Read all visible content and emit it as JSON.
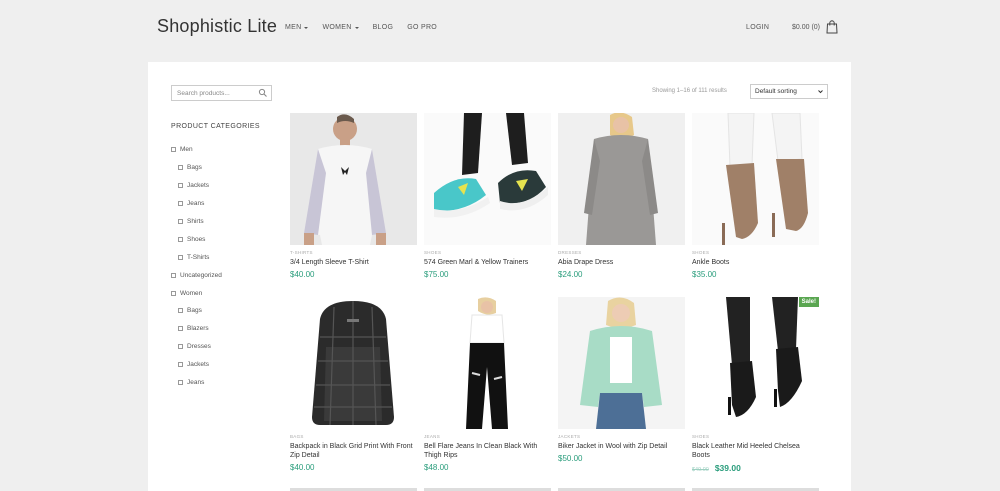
{
  "header": {
    "logo": "Shophistic Lite",
    "nav": [
      {
        "label": "MEN",
        "dropdown": true
      },
      {
        "label": "WOMEN",
        "dropdown": true
      },
      {
        "label": "BLOG",
        "dropdown": false
      },
      {
        "label": "GO PRO",
        "dropdown": false
      }
    ],
    "login": "LOGIN",
    "cart": "$0.00 (0)"
  },
  "sidebar": {
    "search_placeholder": "Search products...",
    "categories_heading": "PRODUCT CATEGORIES",
    "categories": [
      {
        "label": "Men",
        "level": 0
      },
      {
        "label": "Bags",
        "level": 1
      },
      {
        "label": "Jackets",
        "level": 1
      },
      {
        "label": "Jeans",
        "level": 1
      },
      {
        "label": "Shirts",
        "level": 1
      },
      {
        "label": "Shoes",
        "level": 1
      },
      {
        "label": "T-Shirts",
        "level": 1
      },
      {
        "label": "Uncategorized",
        "level": 0
      },
      {
        "label": "Women",
        "level": 0
      },
      {
        "label": "Bags",
        "level": 1
      },
      {
        "label": "Blazers",
        "level": 1
      },
      {
        "label": "Dresses",
        "level": 1
      },
      {
        "label": "Jackets",
        "level": 1
      },
      {
        "label": "Jeans",
        "level": 1
      }
    ]
  },
  "toolbar": {
    "results": "Showing 1–16 of 111 results",
    "sorting": "Default sorting"
  },
  "products": [
    {
      "category": "T-SHIRTS",
      "name": "3/4 Length Sleeve T-Shirt",
      "price": "$40.00"
    },
    {
      "category": "SHOES",
      "name": "574 Green Marl & Yellow Trainers",
      "price": "$75.00"
    },
    {
      "category": "DRESSES",
      "name": "Abia Drape Dress",
      "price": "$24.00"
    },
    {
      "category": "SHOES",
      "name": "Ankle Boots",
      "price": "$35.00"
    },
    {
      "category": "BAGS",
      "name": "Backpack in Black Grid Print With Front Zip Detail",
      "price": "$40.00"
    },
    {
      "category": "JEANS",
      "name": "Bell Flare Jeans In Clean Black With Thigh Rips",
      "price": "$48.00"
    },
    {
      "category": "JACKETS",
      "name": "Biker Jacket in Wool with Zip Detail",
      "price": "$50.00"
    },
    {
      "category": "SHOES",
      "name": "Black Leather Mid Heeled Chelsea Boots",
      "old_price": "$49.00",
      "price": "$39.00",
      "badge": "Sale!"
    }
  ],
  "colors": {
    "accent": "#2a9d7c",
    "sale": "#5aa651"
  }
}
